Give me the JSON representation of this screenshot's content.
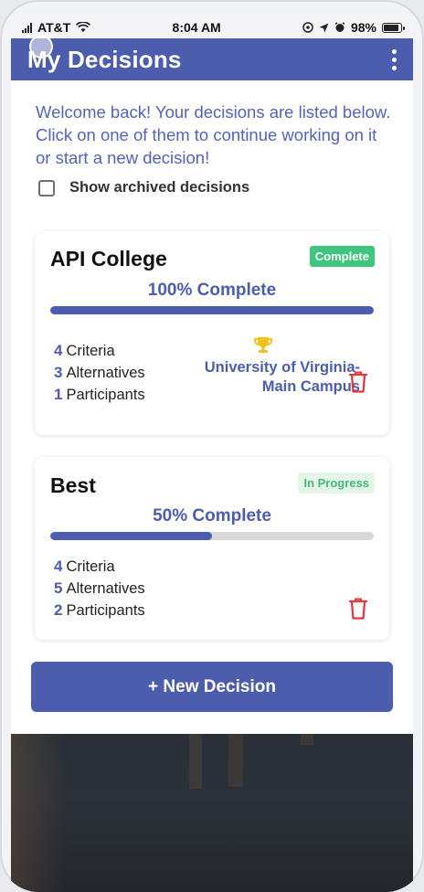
{
  "status_bar": {
    "carrier": "AT&T",
    "time": "8:04 AM",
    "battery": "98%"
  },
  "header": {
    "title": "My Decisions"
  },
  "welcome_text": "Welcome back! Your decisions are listed below. Click on one of them to continue working on it or start a new decision!",
  "archived_toggle": {
    "label": "Show archived decisions",
    "checked": false
  },
  "decisions": [
    {
      "title": "API College",
      "status": "Complete",
      "percent_label": "100% Complete",
      "progress": 1.0,
      "criteria_count": "4",
      "criteria_label": "Criteria",
      "alternatives_count": "3",
      "alternatives_label": "Alternatives",
      "participants_count": "1",
      "participants_label": "Participants",
      "winner": "University of Virginia-Main Campus"
    },
    {
      "title": "Best",
      "status": "In Progress",
      "percent_label": "50% Complete",
      "progress": 0.5,
      "criteria_count": "4",
      "criteria_label": "Criteria",
      "alternatives_count": "5",
      "alternatives_label": "Alternatives",
      "participants_count": "2",
      "participants_label": "Participants"
    }
  ],
  "new_decision_button": "+ New Decision",
  "colors": {
    "primary": "#4d5dad",
    "complete_badge": "#3ec57e",
    "in_progress_text": "#45b971",
    "trash": "#e0373e",
    "trophy": "#f3c21a"
  }
}
